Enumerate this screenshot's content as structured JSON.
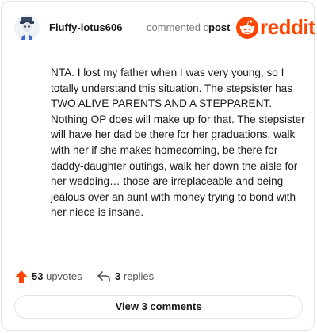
{
  "header": {
    "username": "Fluffy-lotus606",
    "action_text": "commented on",
    "target_text": "post",
    "logo_text": "reddit"
  },
  "comment": {
    "text": "NTA. I lost my father when I was very young, so I totally understand this situation. The stepsister has TWO ALIVE PARENTS AND A STEPPARENT. Nothing OP does will make up for that. The stepsister will have her dad be there for her graduations, walk with her if she makes homecoming, be there for daddy-daughter outings, walk her down the aisle for her wedding… those are irreplaceable and being jealous over an aunt with money trying to bond with her niece is insane."
  },
  "footer": {
    "upvotes_count": "53",
    "upvotes_label": "upvotes",
    "replies_count": "3",
    "replies_label": "replies",
    "view_comments_label": "View 3 comments"
  },
  "colors": {
    "brand": "#ff4500",
    "text": "#1a1a1b",
    "muted": "#7c7c7c",
    "border": "#e3e3e3"
  },
  "icons": {
    "avatar": "user-avatar-icon",
    "logo": "reddit-snoo-icon",
    "upvote": "upvote-arrow-icon",
    "reply": "reply-arrow-icon"
  }
}
